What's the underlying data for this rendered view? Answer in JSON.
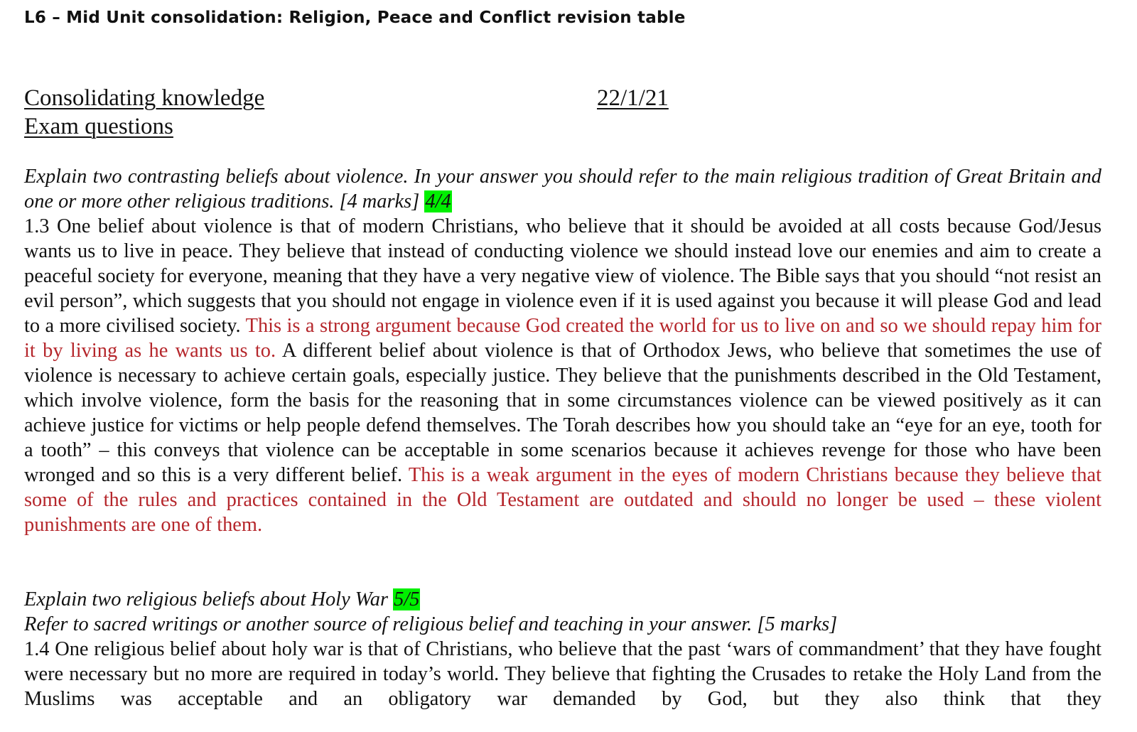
{
  "document": {
    "title": "L6 – Mid Unit consolidation: Religion, Peace and Conflict revision table",
    "heading_line1": "Consolidating knowledge",
    "heading_line2": "Exam questions",
    "date": "22/1/21"
  },
  "question1": {
    "prompt": "Explain two contrasting beliefs about violence. In your answer you should refer to the main religious tradition of Great Britain and one or more other religious traditions. [4 marks]",
    "score": "4/4",
    "answer_part1": "1.3 One belief about violence is that of modern Christians, who believe that it should be avoided at all costs because God/Jesus wants us to live in peace. They believe that instead of conducting violence we should instead love our enemies and aim to create a peaceful society for everyone, meaning that they have a very negative view of violence. The Bible says that you should “not resist an evil person”, which suggests that you should not engage in violence even if it is used against you because it will please God and lead to a more civilised society.",
    "feedback1": "This is a strong argument because God created the world for us to live on and so we should repay him for it by living as he wants us to.",
    "answer_part2": "A different belief about violence is that of Orthodox Jews, who believe that sometimes the use of violence is necessary to achieve certain goals, especially justice. They believe that the punishments described in the Old Testament, which involve violence, form the basis for the reasoning that in some circumstances violence can be viewed positively as it can achieve justice for victims or help people defend themselves. The Torah describes how you should take an “eye for an eye, tooth for a tooth” – this conveys that violence can be acceptable in some scenarios because it achieves revenge for those who have been wronged and so this is a very different belief.",
    "feedback2": "This is a weak argument in the eyes of modern Christians because they believe that some of the rules and practices contained in the Old Testament are outdated and should no longer be used – these violent punishments are one of them."
  },
  "question2": {
    "prompt_line1": "Explain two religious beliefs about Holy War",
    "score": "5/5",
    "prompt_line2": "Refer to sacred writings or another source of religious belief and teaching in your answer. [5 marks]",
    "answer": "1.4 One religious belief about holy war is that of Christians, who believe that the past ‘wars of commandment’ that they have fought were necessary but no more are required in today’s world. They believe that fighting the Crusades to retake the Holy Land from the Muslims was acceptable and an obligatory war demanded by God, but they also think that they"
  },
  "colors": {
    "text": "#111111",
    "feedback_red": "#b5262b",
    "score_highlight": "#00f000"
  }
}
